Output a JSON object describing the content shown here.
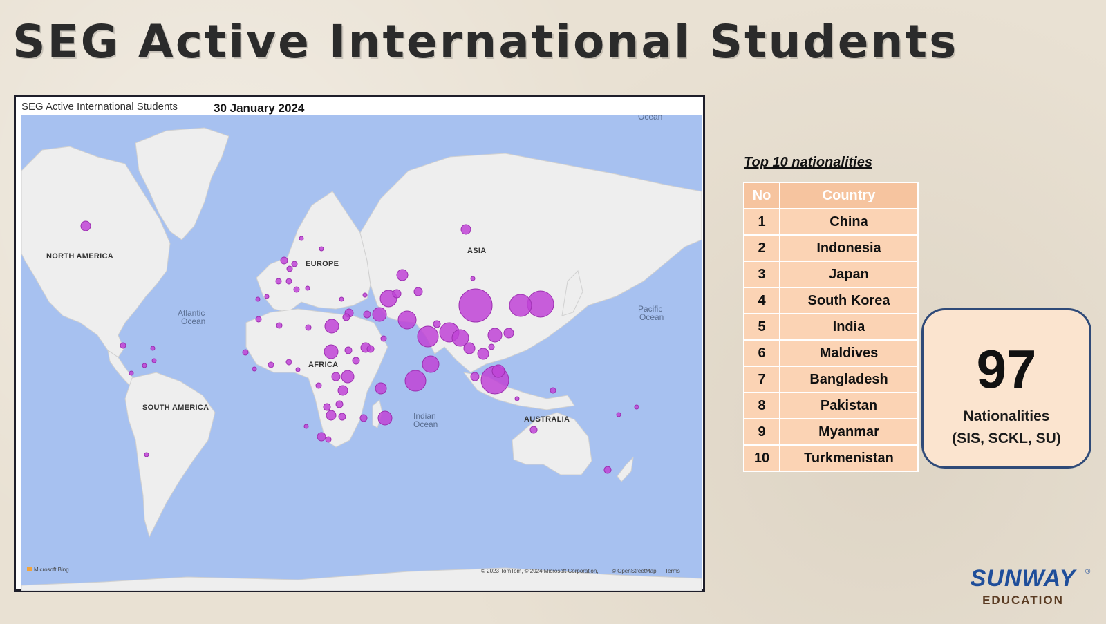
{
  "page": {
    "title": "SEG Active International Students"
  },
  "map": {
    "visual_title": "SEG Active International Students",
    "date": "30 January 2024",
    "region_labels": {
      "north_america": "NORTH AMERICA",
      "south_america": "SOUTH AMERICA",
      "europe": "EUROPE",
      "asia": "ASIA",
      "africa": "AFRICA",
      "australia": "AUSTRALIA"
    },
    "ocean_labels": {
      "atlantic_1": "Atlantic",
      "atlantic_2": "Ocean",
      "pacific_1": "Pacific",
      "pacific_2": "Ocean",
      "indian_1": "Indian",
      "indian_2": "Ocean",
      "arctic": "Ocean"
    },
    "bing_logo": "Microsoft Bing",
    "copyright": "© 2023 TomTom, © 2024 Microsoft Corporation,",
    "osm_link": "© OpenStreetMap",
    "terms_link": "Terms",
    "colors": {
      "water": "#a7c1f0",
      "land": "#eeeeee",
      "bubble": "#c043d6"
    }
  },
  "top10": {
    "title": "Top 10 nationalities",
    "headers": {
      "no": "No",
      "country": "Country"
    },
    "rows": [
      {
        "no": "1",
        "country": "China"
      },
      {
        "no": "2",
        "country": "Indonesia"
      },
      {
        "no": "3",
        "country": "Japan"
      },
      {
        "no": "4",
        "country": "South Korea"
      },
      {
        "no": "5",
        "country": "India"
      },
      {
        "no": "6",
        "country": "Maldives"
      },
      {
        "no": "7",
        "country": "Bangladesh"
      },
      {
        "no": "8",
        "country": "Pakistan"
      },
      {
        "no": "9",
        "country": "Myanmar"
      },
      {
        "no": "10",
        "country": "Turkmenistan"
      }
    ]
  },
  "nationalities": {
    "count": "97",
    "label": "Nationalities",
    "sources": "(SIS, SCKL, SU)"
  },
  "brand": {
    "name": "SUNWAY",
    "reg": "®",
    "sub": "EDUCATION"
  }
}
